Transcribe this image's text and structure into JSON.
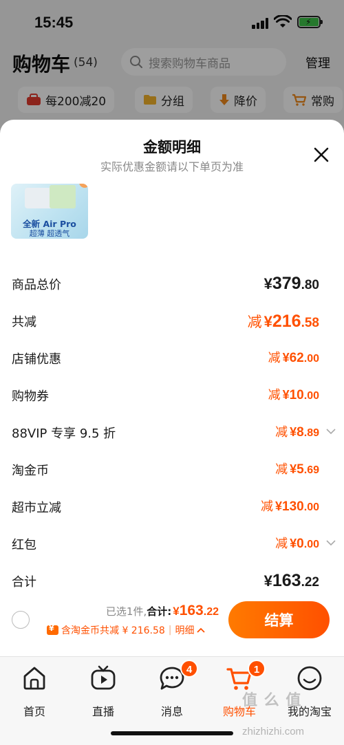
{
  "status_bar": {
    "time": "15:45"
  },
  "cart_header": {
    "title": "购物车",
    "count": "(54)",
    "search_placeholder": "搜索购物车商品",
    "manage_label": "管理"
  },
  "filters": [
    {
      "label": "每200减20",
      "icon": "bag-icon"
    },
    {
      "label": "分组",
      "icon": "folder-icon"
    },
    {
      "label": "降价",
      "icon": "arrow-down-icon"
    },
    {
      "label": "常购",
      "icon": "cart-icon"
    }
  ],
  "sheet": {
    "title": "金额明细",
    "subtitle": "实际优惠金额请以下单页为准",
    "product_thumb": {
      "line1": "全新 Air Pro",
      "line2": "超薄 超透气"
    },
    "rows": [
      {
        "label": "商品总价",
        "prefix": "",
        "currency": "¥",
        "int": "379",
        "dec": ".80",
        "color": "#1a1a1a",
        "size": "lg"
      },
      {
        "label": "共减",
        "prefix": "减",
        "currency": "¥",
        "int": "216",
        "dec": ".58",
        "color": "#ff5000",
        "size": "lg"
      },
      {
        "label": "店铺优惠",
        "prefix": "减",
        "currency": "¥",
        "int": "62",
        "dec": ".00",
        "color": "#ff5000",
        "size": "sm"
      },
      {
        "label": "购物券",
        "prefix": "减",
        "currency": "¥",
        "int": "10",
        "dec": ".00",
        "color": "#ff5000",
        "size": "sm"
      },
      {
        "label": "88VIP 专享 9.5 折",
        "prefix": "减",
        "currency": "¥",
        "int": "8",
        "dec": ".89",
        "color": "#ff5000",
        "size": "sm",
        "chevron": true
      },
      {
        "label": "淘金币",
        "prefix": "减",
        "currency": "¥",
        "int": "5",
        "dec": ".69",
        "color": "#ff5000",
        "size": "sm"
      },
      {
        "label": "超市立减",
        "prefix": "减",
        "currency": "¥",
        "int": "130",
        "dec": ".00",
        "color": "#ff5000",
        "size": "sm"
      },
      {
        "label": "红包",
        "prefix": "减",
        "currency": "¥",
        "int": "0",
        "dec": ".00",
        "color": "#ff5000",
        "size": "sm",
        "chevron": true
      },
      {
        "label": "合计",
        "prefix": "",
        "currency": "¥",
        "int": "163",
        "dec": ".22",
        "color": "#1a1a1a",
        "size": "lg"
      }
    ],
    "footer": {
      "selected_count": "已选1件,",
      "total_label": "合计:",
      "total_currency": "¥",
      "total_int": "163",
      "total_dec": ".22",
      "coin_note": "含淘金币共减 ¥ 216.58",
      "detail_label": "明细",
      "checkout_label": "结算"
    }
  },
  "tabbar": [
    {
      "label": "首页",
      "icon": "home-icon",
      "badge": ""
    },
    {
      "label": "直播",
      "icon": "live-play-icon",
      "badge": ""
    },
    {
      "label": "消息",
      "icon": "message-bubble-icon",
      "badge": "4"
    },
    {
      "label": "购物车",
      "icon": "cart-icon",
      "badge": "1",
      "active": true
    },
    {
      "label": "我的淘宝",
      "icon": "smile-face-icon",
      "badge": ""
    }
  ],
  "watermark": {
    "main": "值 么 值",
    "url": "zhizhizhi.com"
  },
  "colors": {
    "accent": "#ff5000",
    "accent_light": "#ff7a00",
    "text": "#1a1a1a",
    "muted": "#888888"
  }
}
